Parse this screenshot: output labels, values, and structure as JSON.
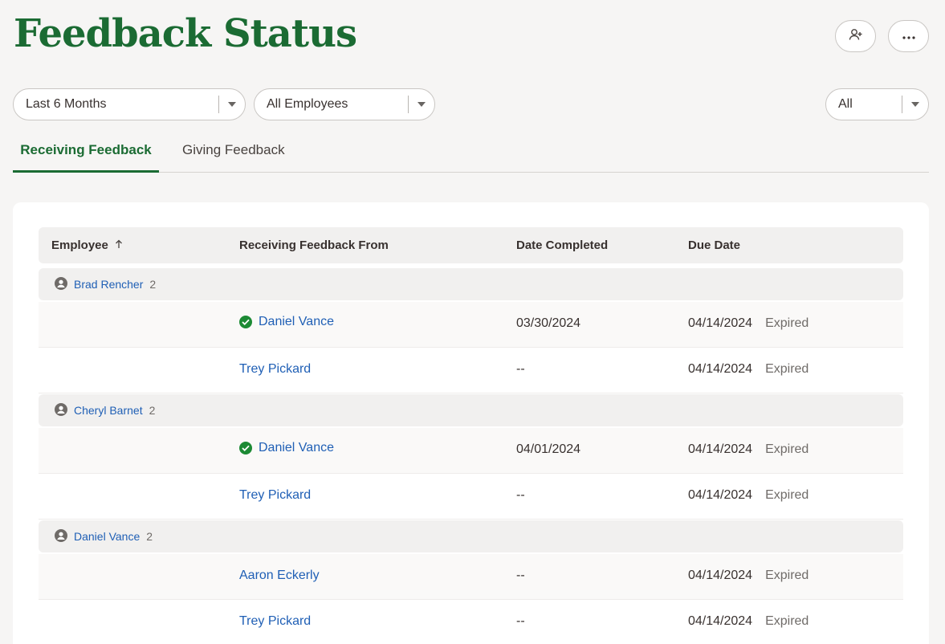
{
  "header": {
    "title": "Feedback Status"
  },
  "toolbar": {
    "add_icon": "person-plus-icon",
    "more_icon": "ellipsis-icon"
  },
  "filters": {
    "period": "Last 6 Months",
    "employees": "All Employees",
    "status": "All"
  },
  "tabs": [
    {
      "label": "Receiving Feedback",
      "active": true
    },
    {
      "label": "Giving Feedback",
      "active": false
    }
  ],
  "table": {
    "columns": [
      "Employee",
      "Receiving Feedback From",
      "Date Completed",
      "Due Date"
    ],
    "groups": [
      {
        "employee": "Brad Rencher",
        "count": "2",
        "rows": [
          {
            "from": "Daniel Vance",
            "completed": true,
            "date_completed": "03/30/2024",
            "due": "04/14/2024",
            "status": "Expired"
          },
          {
            "from": "Trey Pickard",
            "completed": false,
            "date_completed": "--",
            "due": "04/14/2024",
            "status": "Expired"
          }
        ]
      },
      {
        "employee": "Cheryl Barnet",
        "count": "2",
        "rows": [
          {
            "from": "Daniel Vance",
            "completed": true,
            "date_completed": "04/01/2024",
            "due": "04/14/2024",
            "status": "Expired"
          },
          {
            "from": "Trey Pickard",
            "completed": false,
            "date_completed": "--",
            "due": "04/14/2024",
            "status": "Expired"
          }
        ]
      },
      {
        "employee": "Daniel Vance",
        "count": "2",
        "rows": [
          {
            "from": "Aaron Eckerly",
            "completed": false,
            "date_completed": "--",
            "due": "04/14/2024",
            "status": "Expired"
          },
          {
            "from": "Trey Pickard",
            "completed": false,
            "date_completed": "--",
            "due": "04/14/2024",
            "status": "Expired"
          }
        ]
      }
    ]
  },
  "colors": {
    "brand_green": "#1b6b33",
    "link_blue": "#1f5fb5",
    "check_green": "#1c8a34"
  }
}
